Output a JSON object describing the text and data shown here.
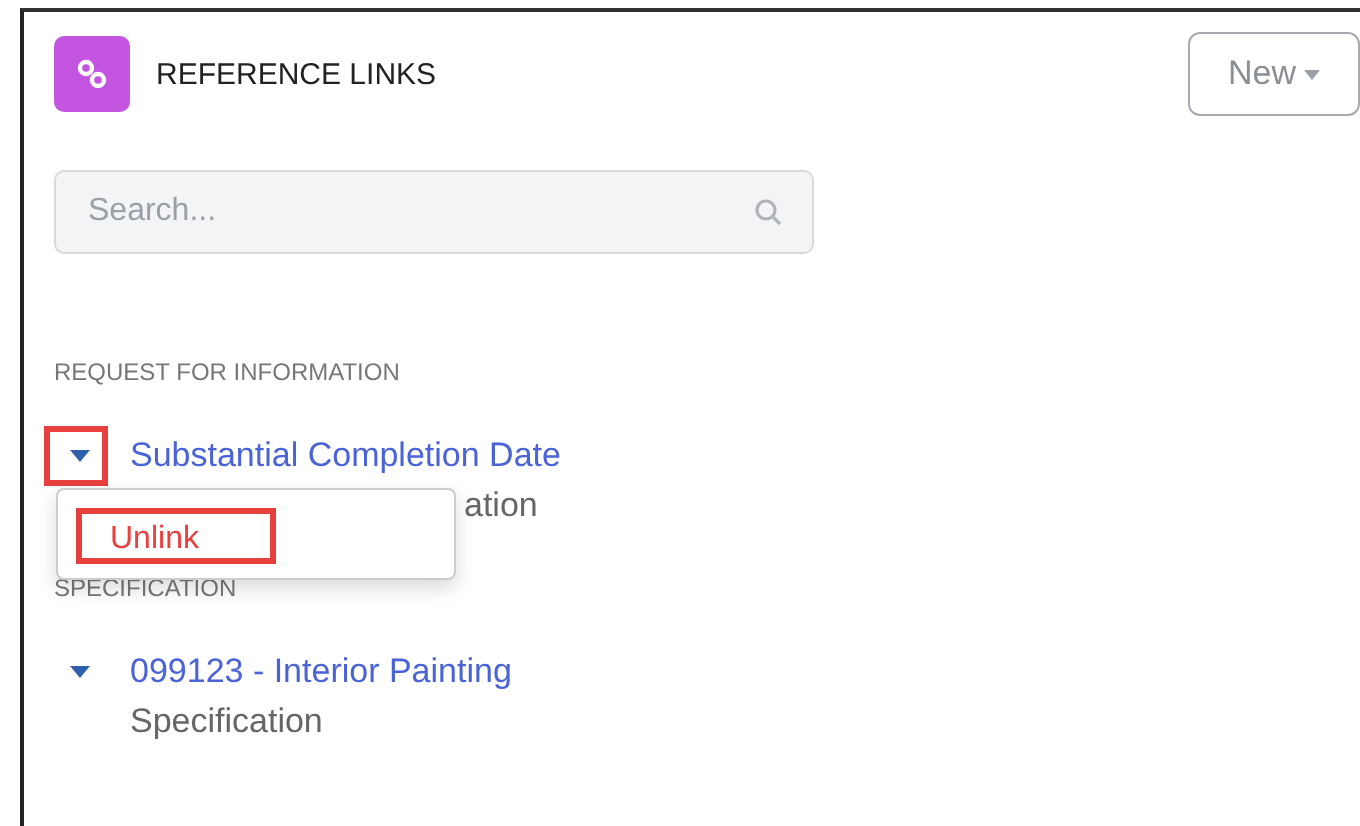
{
  "panel": {
    "title": "REFERENCE LINKS",
    "new_button": {
      "label": "New"
    }
  },
  "search": {
    "placeholder": "Search..."
  },
  "sections": [
    {
      "heading": "REQUEST FOR INFORMATION",
      "items": [
        {
          "title": "Substantial Completion Date",
          "subtitle": "ation",
          "highlighted": true,
          "menu": [
            {
              "label": "Unlink",
              "highlighted": true
            }
          ]
        }
      ]
    },
    {
      "heading": "SPECIFICATION",
      "items": [
        {
          "title": "099123 - Interior Painting",
          "subtitle": "Specification",
          "highlighted": false
        }
      ]
    }
  ]
}
